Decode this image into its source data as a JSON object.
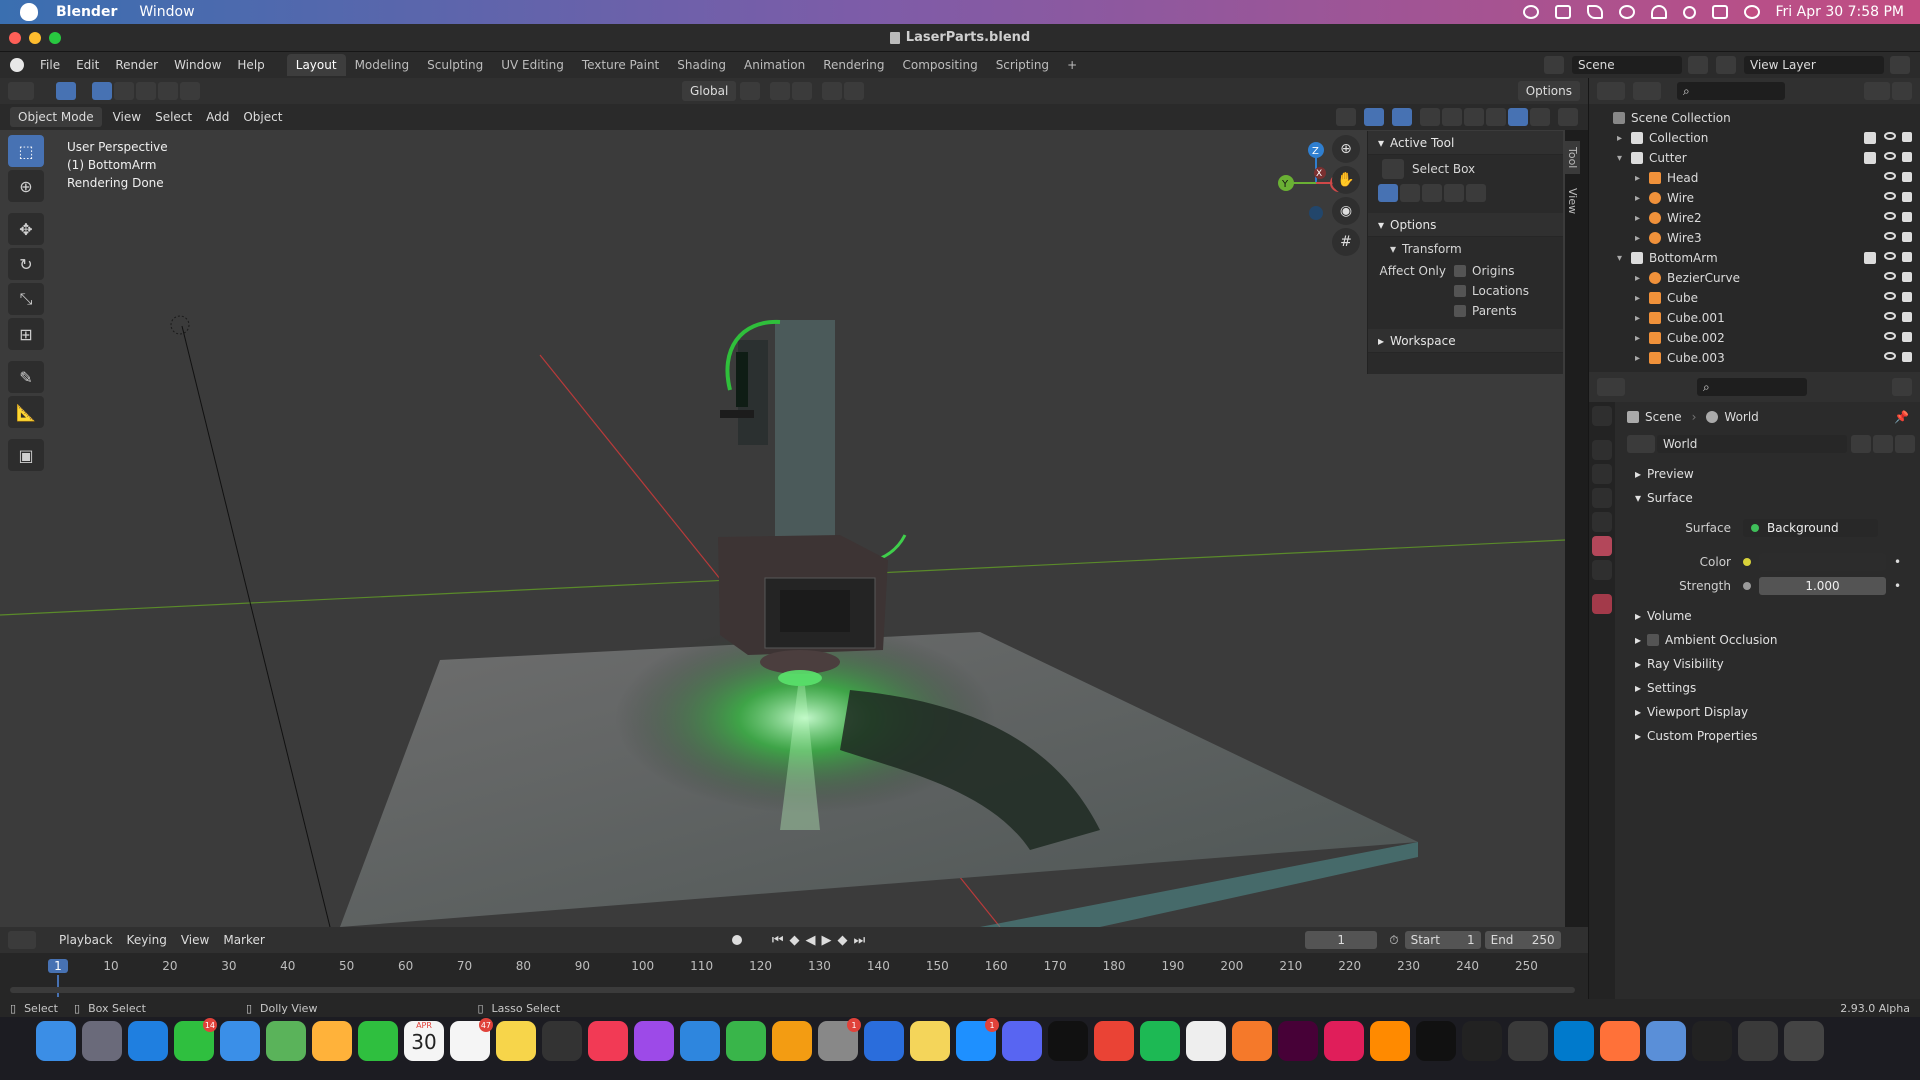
{
  "mac_menubar": {
    "app_name": "Blender",
    "menu_window": "Window",
    "clock": "Fri Apr 30  7:58 PM"
  },
  "window": {
    "title": "LaserParts.blend"
  },
  "top_menu": {
    "items": [
      "File",
      "Edit",
      "Render",
      "Window",
      "Help"
    ],
    "workspaces": [
      "Layout",
      "Modeling",
      "Sculpting",
      "UV Editing",
      "Texture Paint",
      "Shading",
      "Animation",
      "Rendering",
      "Compositing",
      "Scripting"
    ],
    "active_workspace": "Layout",
    "add_workspace": "+",
    "scene_label": "Scene",
    "view_layer_label": "View Layer"
  },
  "viewport_header": {
    "transform_orientation": "Global",
    "options": "Options",
    "mode": "Object Mode",
    "menus": [
      "View",
      "Select",
      "Add",
      "Object"
    ]
  },
  "viewport_overlay": {
    "line1": "User Perspective",
    "line2": "(1) BottomArm",
    "line3": "Rendering Done"
  },
  "gizmo": {
    "z": "Z",
    "y": "Y",
    "x": "X"
  },
  "npanel": {
    "active_tool_header": "Active Tool",
    "tool_name": "Select Box",
    "options_header": "Options",
    "transform_header": "Transform",
    "affect_only": "Affect Only",
    "origins": "Origins",
    "locations": "Locations",
    "parents": "Parents",
    "workspace_header": "Workspace",
    "tab_tool": "Tool",
    "tab_view": "View"
  },
  "outliner": {
    "scene_collection": "Scene Collection",
    "rows": [
      {
        "label": "Collection",
        "indent": 1,
        "kind": "collection",
        "checkbox": true
      },
      {
        "label": "Cutter",
        "indent": 1,
        "kind": "collection",
        "checkbox": true,
        "expanded": true
      },
      {
        "label": "Head",
        "indent": 2,
        "kind": "mesh"
      },
      {
        "label": "Wire",
        "indent": 2,
        "kind": "curve"
      },
      {
        "label": "Wire2",
        "indent": 2,
        "kind": "curve"
      },
      {
        "label": "Wire3",
        "indent": 2,
        "kind": "curve"
      },
      {
        "label": "BottomArm",
        "indent": 1,
        "kind": "collection",
        "checkbox": true,
        "expanded": true
      },
      {
        "label": "BezierCurve",
        "indent": 2,
        "kind": "curve"
      },
      {
        "label": "Cube",
        "indent": 2,
        "kind": "mesh"
      },
      {
        "label": "Cube.001",
        "indent": 2,
        "kind": "mesh"
      },
      {
        "label": "Cube.002",
        "indent": 2,
        "kind": "mesh"
      },
      {
        "label": "Cube.003",
        "indent": 2,
        "kind": "mesh"
      }
    ]
  },
  "properties": {
    "breadcrumb_scene": "Scene",
    "breadcrumb_world": "World",
    "world_name": "World",
    "sections": {
      "preview": "Preview",
      "surface": "Surface",
      "volume": "Volume",
      "ambient_occlusion": "Ambient Occlusion",
      "ray_visibility": "Ray Visibility",
      "settings": "Settings",
      "viewport_display": "Viewport Display",
      "custom_properties": "Custom Properties"
    },
    "surface_label": "Surface",
    "surface_value": "Background",
    "color_label": "Color",
    "strength_label": "Strength",
    "strength_value": "1.000"
  },
  "timeline": {
    "menus": [
      "Playback",
      "Keying",
      "View",
      "Marker"
    ],
    "current_frame": "1",
    "start_label": "Start",
    "start_value": "1",
    "end_label": "End",
    "end_value": "250",
    "ticks": [
      "1",
      "10",
      "20",
      "30",
      "40",
      "50",
      "60",
      "70",
      "80",
      "90",
      "100",
      "110",
      "120",
      "130",
      "140",
      "150",
      "160",
      "170",
      "180",
      "190",
      "200",
      "210",
      "220",
      "230",
      "240",
      "250"
    ]
  },
  "statusbar": {
    "select": "Select",
    "box_select": "Box Select",
    "dolly_view": "Dolly View",
    "lasso_select": "Lasso Select",
    "version": "2.93.0 Alpha"
  },
  "dock": {
    "calendar_month": "APR",
    "calendar_day": "30",
    "badges": {
      "messages": "14",
      "reminders": "47",
      "settings": "1",
      "appstore": "1"
    },
    "apps": [
      "finder",
      "launchpad",
      "safari",
      "messages",
      "mail",
      "maps",
      "photos",
      "facetime",
      "calendar",
      "reminders",
      "notes",
      "keynote-like",
      "music",
      "podcasts",
      "keynote",
      "numbers",
      "pages",
      "system-preferences",
      "xcode",
      "stickies",
      "app-store",
      "discord",
      "terminal",
      "chrome",
      "spotify",
      "unity",
      "blender",
      "adobe-xd",
      "slack",
      "books",
      "intellij",
      "github",
      "sublime",
      "vscode",
      "firefox",
      "preview",
      "unity-hub",
      "photo-booth",
      "trash"
    ]
  }
}
